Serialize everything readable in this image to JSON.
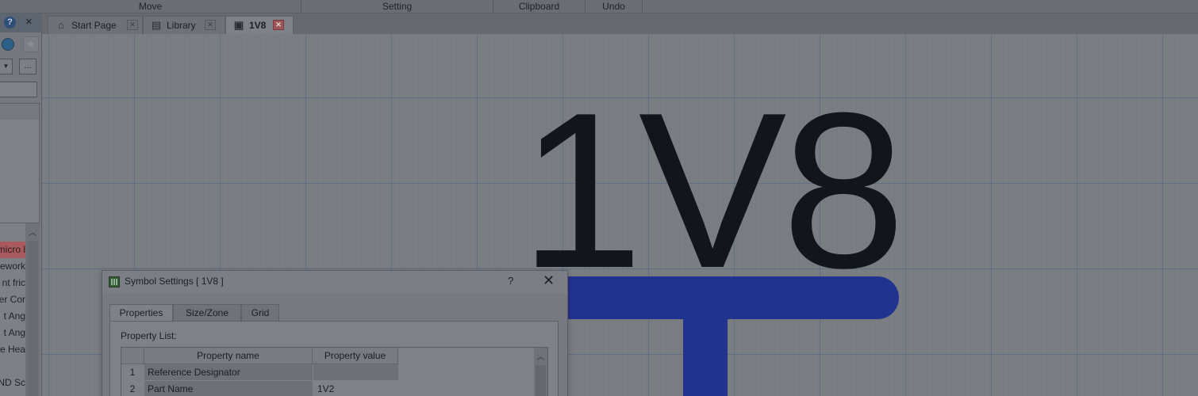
{
  "ribbon": {
    "groups": [
      "Move",
      "Setting",
      "Clipboard",
      "Undo"
    ]
  },
  "left_panel": {
    "help_icon": "?",
    "close_icon": "×",
    "more_label": "...",
    "list_items": [
      "micro l",
      "rework",
      "nt fric",
      "er Cor",
      "t Ang",
      "t Ang",
      "e Hea",
      "ND Sc"
    ]
  },
  "tabs": [
    {
      "label": "Start Page",
      "icon": "home-icon"
    },
    {
      "label": "Library",
      "icon": "book-icon"
    },
    {
      "label": "1V8",
      "icon": "symbol-file-icon",
      "active": true
    }
  ],
  "canvas": {
    "symbol_text": "1V8",
    "colors": {
      "symbol_text": "#12161c",
      "symbol_shape": "#22338f",
      "grid": "#4e6582"
    }
  },
  "dialog": {
    "title": "Symbol Settings   [ 1V8 ]",
    "help": "?",
    "close": "✕",
    "tabs": [
      "Properties",
      "Size/Zone",
      "Grid"
    ],
    "active_tab": "Properties",
    "property_list_label": "Property List:",
    "table": {
      "columns": [
        "Property name",
        "Property value"
      ],
      "rows": [
        {
          "num": "1",
          "name": "Reference Designator",
          "value": ""
        },
        {
          "num": "2",
          "name": "Part Name",
          "value": "1V2"
        }
      ]
    }
  }
}
